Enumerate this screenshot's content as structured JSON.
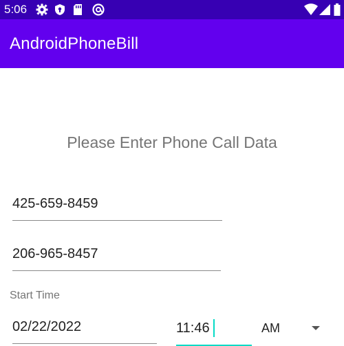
{
  "status_bar": {
    "time": "5:06",
    "icons": [
      "gear-icon",
      "shield-icon",
      "sd-card-icon",
      "at-sign-icon",
      "wifi-icon",
      "signal-icon",
      "battery-icon"
    ]
  },
  "app_bar": {
    "title": "AndroidPhoneBill"
  },
  "main": {
    "prompt": "Please Enter Phone Call Data",
    "caller_number": "425-659-8459",
    "callee_number": "206-965-8457",
    "start_time_label": "Start Time",
    "start_date": "02/22/2022",
    "start_time": "11:46",
    "am_pm": "AM"
  },
  "colors": {
    "status_bar": "#3700B3",
    "app_bar": "#6200EE",
    "accent": "#03DAC5"
  }
}
